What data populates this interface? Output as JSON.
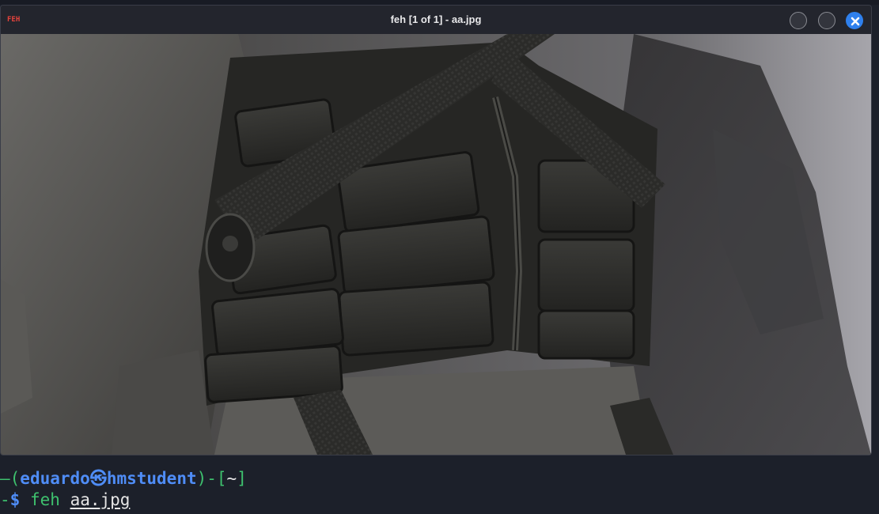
{
  "window": {
    "app_icon_text": "FEH",
    "title": "feh [1 of 1] - aa.jpg",
    "controls": {
      "minimize_icon": "circle-icon",
      "maximize_icon": "circle-icon",
      "close_icon": "close-icon"
    }
  },
  "image": {
    "subject": "tactical-vest-photo"
  },
  "terminal": {
    "prompt_open": "—(",
    "user": "eduardo",
    "at_symbol": "㉿",
    "host": "hmstudent",
    "prompt_mid": ")-[",
    "cwd": "~",
    "prompt_close": "]",
    "line2_prefix": "-",
    "dollar": "$",
    "command": "feh",
    "argument": "aa.jpg"
  },
  "colors": {
    "accent_close": "#2f80ed",
    "prompt_green": "#3ec16e",
    "prompt_blue": "#4f8df7",
    "feh_icon_red": "#e8433c"
  }
}
